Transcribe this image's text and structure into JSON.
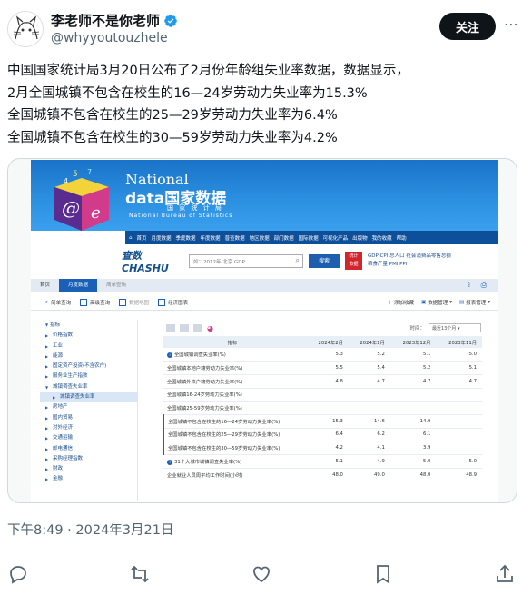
{
  "author": {
    "name": "李老师不是你老师",
    "handle": "@whyyoutouzhele",
    "verified": true
  },
  "follow_label": "关注",
  "tweet_lines": [
    "中国国家统计局3月20日公布了2月份年龄组失业率数据，数据显示，",
    "2月全国城镇不包含在校生的16—24岁劳动力失业率为15.3%",
    "全国城镇不包含在校生的25—29岁劳动力失业率为6.4%",
    "全国城镇不包含在校生的30—59岁劳动力失业率为4.2%"
  ],
  "screenshot": {
    "brand": {
      "line1": "National",
      "line2": "data国家数据",
      "line3": "国 家 统 计 局",
      "line4": "National Bureau of Statistics"
    },
    "nav_items": [
      "首页",
      "月度数据",
      "季度数据",
      "年度数据",
      "普查数据",
      "地区数据",
      "部门数据",
      "国际数据",
      "可视化产品",
      "出版物",
      "我的收藏",
      "帮助"
    ],
    "search": {
      "logo": "查数 CHASHU",
      "placeholder": "如：2012年 北京 GDP",
      "button": "搜索",
      "red_button": "统计\n数据",
      "links_row1": "GDP   CPI   总人口   社会消费品零售总额",
      "links_row2": "粮食产量   PMI   PPI"
    },
    "breadcrumb": [
      "首页",
      "月度数据",
      "简单查询"
    ],
    "toolbar": {
      "items": [
        "简单查询",
        "高级查询",
        "数据地图",
        "经济图表"
      ],
      "right": [
        "添加收藏",
        "数据管理",
        "报表管理"
      ]
    },
    "sidebar": {
      "head": "指标",
      "items": [
        "价格指数",
        "工业",
        "能源",
        "固定资产投资(不含农户)",
        "服务业生产指数"
      ],
      "open_item": "城镇调查失业率",
      "sub_item": "城镇调查失业率",
      "items_after": [
        "房地产",
        "国内贸易",
        "对外经济",
        "交通运输",
        "邮电通信",
        "采购经理指数",
        "财政",
        "金融"
      ]
    },
    "table": {
      "time_label": "时间：",
      "time_value": "最近13个月",
      "header_label": "指标",
      "columns": [
        "2024年2月",
        "2024年1月",
        "2023年12月",
        "2023年11月"
      ],
      "rows": [
        {
          "label": "全国城镇调查失业率(%)",
          "info": true,
          "values": [
            "5.3",
            "5.2",
            "5.1",
            "5.0"
          ]
        },
        {
          "label": "全国城镇本地户籍劳动力失业率(%)",
          "info": false,
          "values": [
            "5.5",
            "5.4",
            "5.2",
            "5.1"
          ]
        },
        {
          "label": "全国城镇外来户籍劳动力失业率(%)",
          "info": false,
          "values": [
            "4.8",
            "4.7",
            "4.7",
            "4.7"
          ]
        },
        {
          "label": "全国城镇16-24岁劳动力失业率(%)",
          "info": false,
          "values": [
            "",
            "",
            "",
            ""
          ]
        },
        {
          "label": "全国城镇25-59岁劳动力失业率(%)",
          "info": false,
          "values": [
            "",
            "",
            "",
            ""
          ]
        },
        {
          "label": "全国城镇不包含在校生的16—24岁劳动力失业率(%)",
          "info": false,
          "values": [
            "15.3",
            "14.6",
            "14.9",
            ""
          ]
        },
        {
          "label": "全国城镇不包含在校生的25—29岁劳动力失业率(%)",
          "info": false,
          "values": [
            "6.4",
            "6.2",
            "6.1",
            ""
          ]
        },
        {
          "label": "全国城镇不包含在校生的30—59岁劳动力失业率(%)",
          "info": false,
          "values": [
            "4.2",
            "4.1",
            "3.9",
            ""
          ]
        },
        {
          "label": "31个大城市城镇调查失业率(%)",
          "info": true,
          "values": [
            "5.1",
            "4.9",
            "5.0",
            "5.0"
          ]
        },
        {
          "label": "企业就业人员周平均工作时间(小时)",
          "info": false,
          "values": [
            "48.0",
            "49.0",
            "48.0",
            "48.9"
          ]
        }
      ]
    }
  },
  "timestamp": "下午8:49 · 2024年3月21日",
  "colors": {
    "accent": "#1d9bf0",
    "banner": "#2b8fe0",
    "nav": "#0e4f9a",
    "text": "#0f1419",
    "muted": "#536471"
  }
}
